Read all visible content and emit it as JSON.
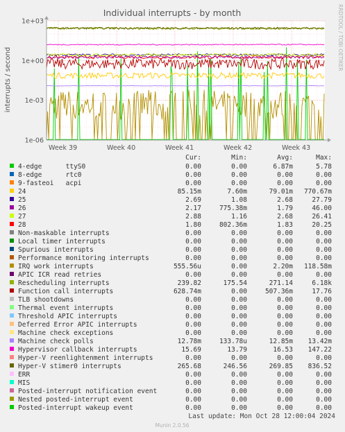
{
  "chart_data": {
    "type": "line",
    "title": "Individual interrupts - by month",
    "ylabel": "interrupts / second",
    "side_label": "RRDTOOL / TOBI OETIKER",
    "yscale": "log",
    "ylim": [
      1e-06,
      1000
    ],
    "y_ticks": [
      {
        "value": 1000,
        "label": "1e+03"
      },
      {
        "value": 1,
        "label": "1e+00"
      },
      {
        "value": 0.001,
        "label": "1e-03"
      },
      {
        "value": 1e-06,
        "label": "1e-06"
      }
    ],
    "x_ticks": [
      "Week 39",
      "Week 40",
      "Week 41",
      "Week 42",
      "Week 43"
    ],
    "legend_header": [
      "Cur:",
      "Min:",
      "Avg:",
      "Max:"
    ],
    "series": [
      {
        "name": "4-edge      ttyS0",
        "color": "#00cc00",
        "cur": "0.00",
        "min": "0.00",
        "avg": "6.87m",
        "max": "5.78"
      },
      {
        "name": "8-edge      rtc0",
        "color": "#0066b3",
        "cur": "0.00",
        "min": "0.00",
        "avg": "0.00",
        "max": "0.00"
      },
      {
        "name": "9-fasteoi   acpi",
        "color": "#ff8000",
        "cur": "0.00",
        "min": "0.00",
        "avg": "0.00",
        "max": "0.00"
      },
      {
        "name": "24",
        "color": "#ffcc00",
        "cur": "85.15m",
        "min": "7.60m",
        "avg": "79.01m",
        "max": "770.67m"
      },
      {
        "name": "25",
        "color": "#330099",
        "cur": "2.69",
        "min": "1.08",
        "avg": "2.68",
        "max": "27.79"
      },
      {
        "name": "26",
        "color": "#990099",
        "cur": "2.17",
        "min": "775.38m",
        "avg": "1.79",
        "max": "46.00"
      },
      {
        "name": "27",
        "color": "#ccff00",
        "cur": "2.88",
        "min": "1.16",
        "avg": "2.68",
        "max": "26.41"
      },
      {
        "name": "28",
        "color": "#ff0000",
        "cur": "1.80",
        "min": "802.36m",
        "avg": "1.83",
        "max": "20.25"
      },
      {
        "name": "Non-maskable interrupts",
        "color": "#808080",
        "cur": "0.00",
        "min": "0.00",
        "avg": "0.00",
        "max": "0.00"
      },
      {
        "name": "Local timer interrupts",
        "color": "#008f00",
        "cur": "0.00",
        "min": "0.00",
        "avg": "0.00",
        "max": "0.00"
      },
      {
        "name": "Spurious interrupts",
        "color": "#00487d",
        "cur": "0.00",
        "min": "0.00",
        "avg": "0.00",
        "max": "0.00"
      },
      {
        "name": "Performance monitoring interrupts",
        "color": "#b35a00",
        "cur": "0.00",
        "min": "0.00",
        "avg": "0.00",
        "max": "0.00"
      },
      {
        "name": "IRQ work interrupts",
        "color": "#b38f00",
        "cur": "555.56u",
        "min": "0.00",
        "avg": "2.20m",
        "max": "118.58m"
      },
      {
        "name": "APIC ICR read retries",
        "color": "#6b006b",
        "cur": "0.00",
        "min": "0.00",
        "avg": "0.00",
        "max": "0.00"
      },
      {
        "name": "Rescheduling interrupts",
        "color": "#8fb300",
        "cur": "239.82",
        "min": "175.54",
        "avg": "271.14",
        "max": "6.18k"
      },
      {
        "name": "Function call interrupts",
        "color": "#b30000",
        "cur": "628.74m",
        "min": "0.00",
        "avg": "507.36m",
        "max": "17.76"
      },
      {
        "name": "TLB shootdowns",
        "color": "#bebebe",
        "cur": "0.00",
        "min": "0.00",
        "avg": "0.00",
        "max": "0.00"
      },
      {
        "name": "Thermal event interrupts",
        "color": "#80ff80",
        "cur": "0.00",
        "min": "0.00",
        "avg": "0.00",
        "max": "0.00"
      },
      {
        "name": "Threshold APIC interrupts",
        "color": "#80c9ff",
        "cur": "0.00",
        "min": "0.00",
        "avg": "0.00",
        "max": "0.00"
      },
      {
        "name": "Deferred Error APIC interrupts",
        "color": "#ffc080",
        "cur": "0.00",
        "min": "0.00",
        "avg": "0.00",
        "max": "0.00"
      },
      {
        "name": "Machine check exceptions",
        "color": "#ffe680",
        "cur": "0.00",
        "min": "0.00",
        "avg": "0.00",
        "max": "0.00"
      },
      {
        "name": "Machine check polls",
        "color": "#aa80ff",
        "cur": "12.78m",
        "min": "133.78u",
        "avg": "12.85m",
        "max": "13.42m"
      },
      {
        "name": "Hypervisor callback interrupts",
        "color": "#ee00cc",
        "cur": "15.69",
        "min": "13.79",
        "avg": "16.53",
        "max": "147.22"
      },
      {
        "name": "Hyper-V reenlightenment interrupts",
        "color": "#ff8080",
        "cur": "0.00",
        "min": "0.00",
        "avg": "0.00",
        "max": "0.00"
      },
      {
        "name": "Hyper-V stimer0 interrupts",
        "color": "#666600",
        "cur": "265.68",
        "min": "246.56",
        "avg": "269.85",
        "max": "836.52"
      },
      {
        "name": "ERR",
        "color": "#ffbfff",
        "cur": "0.00",
        "min": "0.00",
        "avg": "0.00",
        "max": "0.00"
      },
      {
        "name": "MIS",
        "color": "#00ffcc",
        "cur": "0.00",
        "min": "0.00",
        "avg": "0.00",
        "max": "0.00"
      },
      {
        "name": "Posted-interrupt notification event",
        "color": "#cc6699",
        "cur": "0.00",
        "min": "0.00",
        "avg": "0.00",
        "max": "0.00"
      },
      {
        "name": "Nested posted-interrupt event",
        "color": "#999900",
        "cur": "0.00",
        "min": "0.00",
        "avg": "0.00",
        "max": "0.00"
      },
      {
        "name": "Posted-interrupt wakeup event",
        "color": "#00cc00",
        "cur": "0.00",
        "min": "0.00",
        "avg": "0.00",
        "max": "0.00"
      }
    ],
    "last_update": "Last update: Mon Oct 28 12:00:04 2024",
    "footer": "Munin 2.0.56"
  }
}
